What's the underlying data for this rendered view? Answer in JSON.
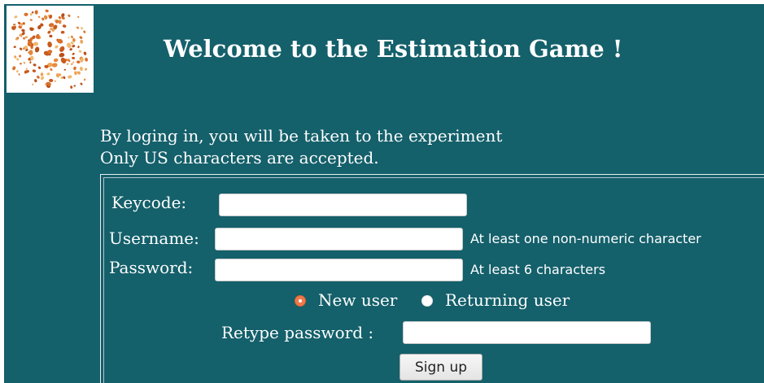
{
  "header": {
    "title": "Welcome to the Estimation Game !",
    "logo_icon": "beans-pile-icon"
  },
  "intro": {
    "line1": "By loging in, you will be taken to the experiment",
    "line2": "Only US characters are accepted."
  },
  "form": {
    "keycode": {
      "label": "Keycode:",
      "value": ""
    },
    "username": {
      "label": "Username:",
      "value": "",
      "hint": "At least one non-numeric character"
    },
    "password": {
      "label": "Password:",
      "value": "",
      "hint": "At least 6 characters"
    },
    "user_type": {
      "options": [
        "New user",
        "Returning user"
      ],
      "selected": "New user"
    },
    "retype_password": {
      "label": "Retype password :",
      "value": ""
    },
    "submit_label": "Sign up"
  },
  "colors": {
    "background": "#14606b",
    "text": "#ffffff",
    "radio_selected": "#ee7a4a"
  }
}
